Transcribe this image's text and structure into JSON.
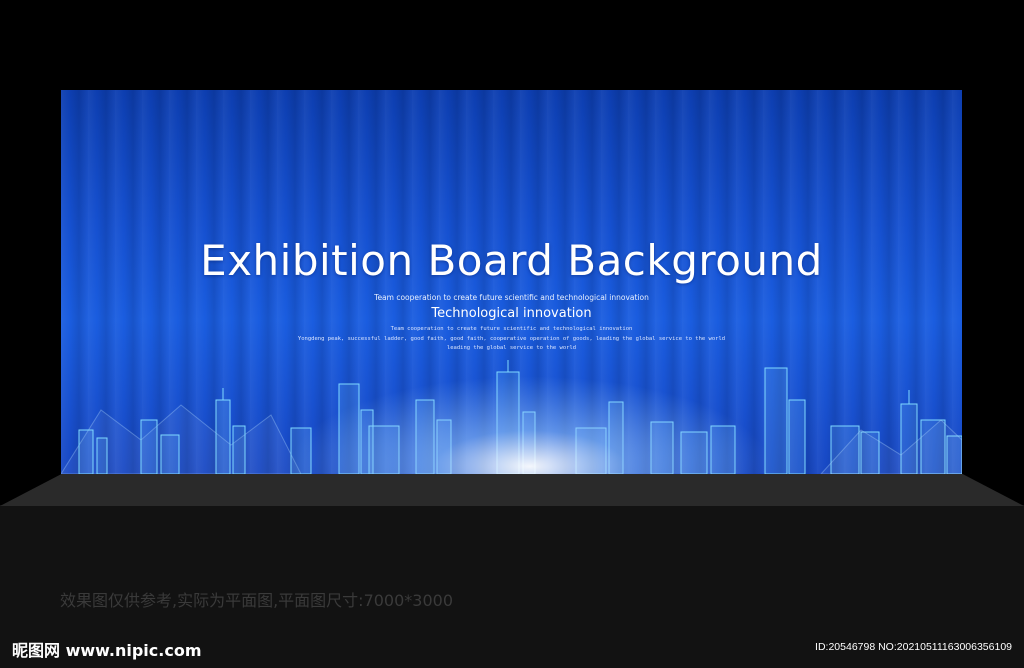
{
  "board": {
    "title": "Exhibition Board Background",
    "tagline": "Team cooperation to create future scientific and technological innovation",
    "subtitle": "Technological innovation",
    "small_lines": [
      "Team cooperation to create future scientific and technological innovation",
      "Yongdeng peak, successful ladder, good faith, good faith, cooperative operation of goods, leading the global service to the world",
      "leading the global service to the world"
    ],
    "colors": {
      "top": "#0d3eb0",
      "mid": "#1a5de0",
      "glow": "#ffffff",
      "outline": "#7fd9ff"
    }
  },
  "caption": "效果图仅供参考,实际为平面图,平面图尺寸:7000*3000",
  "watermark": {
    "logo": "昵图网 www.nipic.com",
    "image_id": "ID:20546798 NO:20210511163006356109"
  }
}
